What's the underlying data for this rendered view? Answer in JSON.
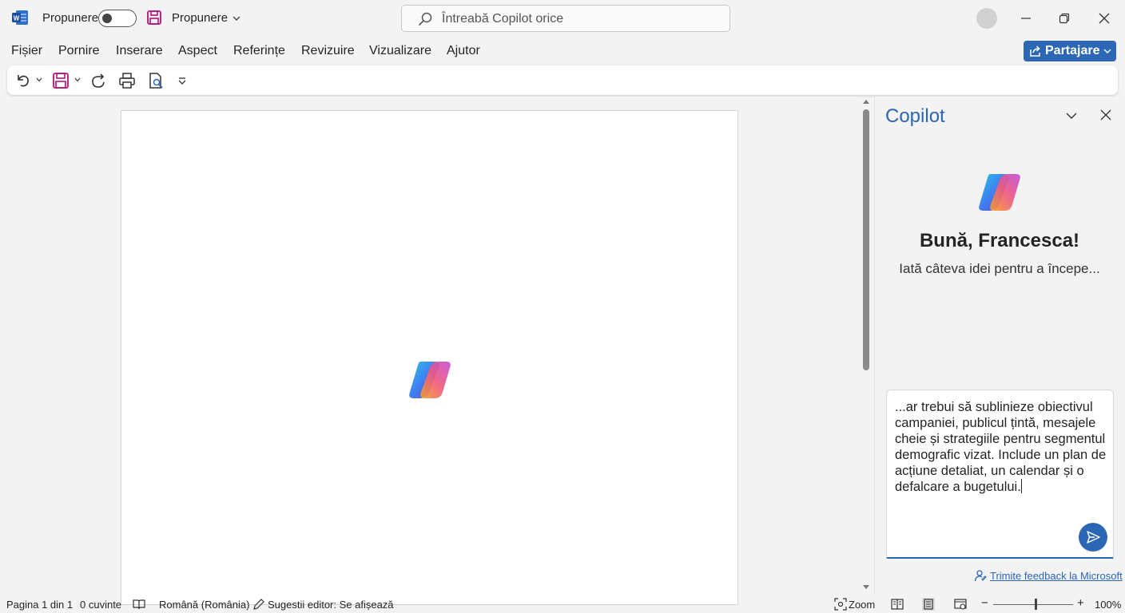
{
  "titlebar": {
    "autosave_label": "Propunere",
    "doc_title": "Propunere",
    "search_placeholder": "Întreabă Copilot orice"
  },
  "menu": {
    "items": [
      "Fișier",
      "Pornire",
      "Inserare",
      "Aspect",
      "Referințe",
      "Revizuire",
      "Vizualizare",
      "Ajutor"
    ],
    "share_label": "Partajare"
  },
  "toolbar": {
    "icons": [
      "undo-icon",
      "save-icon",
      "redo-icon",
      "print-icon",
      "print-preview-icon",
      "customize-toolbar-icon"
    ]
  },
  "copilot": {
    "title": "Copilot",
    "greeting": "Bună, Francesca!",
    "subtitle": "Iată câteva idei pentru a începe...",
    "input_value": "...ar trebui să sublinieze obiectivul campaniei, publicul țintă, mesajele cheie și strategiile pentru segmentul demografic vizat. Include un plan de acțiune detaliat, un calendar și o defalcare a bugetului.",
    "feedback_link": "Trimite feedback la Microsoft"
  },
  "statusbar": {
    "page": "Pagina 1 din 1",
    "words": "0 cuvinte",
    "language": "Română (România)",
    "editor_suggestions": "Sugestii editor: Se afișează",
    "focus_label": "Zoom",
    "zoom_level": "100%"
  },
  "colors": {
    "accent": "#2b67b5",
    "background": "#f3f3f3"
  }
}
